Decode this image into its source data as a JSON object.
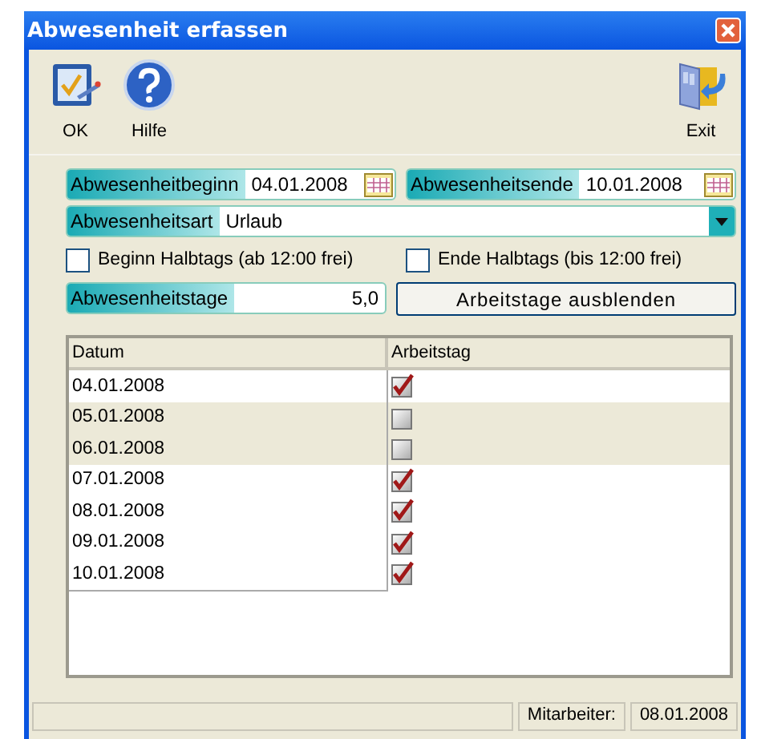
{
  "window": {
    "title": "Abwesenheit erfassen"
  },
  "toolbar": [
    {
      "label": "OK",
      "kind": "ok"
    },
    {
      "label": "Hilfe",
      "kind": "help"
    },
    {
      "label": "Exit",
      "kind": "exit"
    }
  ],
  "beginn": {
    "label": "Abwesenheitbeginn",
    "value": "04.01.2008"
  },
  "ende": {
    "label": "Abwesenheitsende",
    "value": "10.01.2008"
  },
  "art": {
    "label": "Abwesenheitsart",
    "value": "Urlaub"
  },
  "checkboxes": [
    {
      "label": "Beginn Halbtags (ab 12:00 frei)",
      "checked": false
    },
    {
      "label": "Ende Halbtags (bis 12:00 frei)",
      "checked": false
    }
  ],
  "tage": {
    "label": "Abwesenheitstage",
    "value": "5,0"
  },
  "toggle_button": "Arbeitstage ausblenden",
  "table": {
    "columns": [
      "Datum",
      "Arbeitstag"
    ],
    "rows": [
      {
        "datum": "04.01.2008",
        "checked": true
      },
      {
        "datum": "05.01.2008",
        "checked": false
      },
      {
        "datum": "06.01.2008",
        "checked": false
      },
      {
        "datum": "07.01.2008",
        "checked": true
      },
      {
        "datum": "08.01.2008",
        "checked": true
      },
      {
        "datum": "09.01.2008",
        "checked": true
      },
      {
        "datum": "10.01.2008",
        "checked": true
      }
    ]
  },
  "status_bar": {
    "label": "Mitarbeiter:",
    "value": "08.01.2008"
  }
}
